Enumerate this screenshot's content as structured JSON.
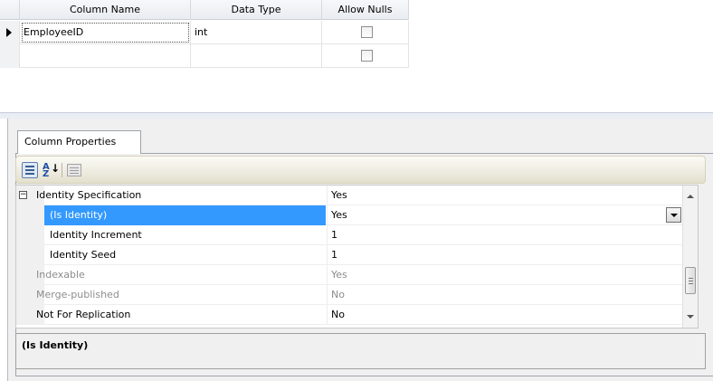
{
  "grid": {
    "columns": [
      "Column Name",
      "Data Type",
      "Allow Nulls"
    ],
    "rows": [
      {
        "name": "EmployeeID",
        "type": "int",
        "allow_nulls": false,
        "current": true
      },
      {
        "name": "",
        "type": "",
        "allow_nulls": false,
        "current": false
      }
    ]
  },
  "panel": {
    "tab_label": "Column Properties",
    "toolbar": [
      "categorized-icon",
      "alphabetical-sort-icon",
      "property-pages-icon"
    ],
    "properties": [
      {
        "name": "Identity Specification",
        "value": "Yes",
        "category": true,
        "expanded": true
      },
      {
        "name": "(Is Identity)",
        "value": "Yes",
        "selected": true
      },
      {
        "name": "Identity Increment",
        "value": "1"
      },
      {
        "name": "Identity Seed",
        "value": "1"
      },
      {
        "name": "Indexable",
        "value": "Yes",
        "readonly": true
      },
      {
        "name": "Merge-published",
        "value": "No",
        "readonly": true
      },
      {
        "name": "Not For Replication",
        "value": "No"
      }
    ],
    "description_title": "(Is Identity)",
    "colors": {
      "selection": "#3399ff",
      "readonly_text": "#8d8d8d"
    }
  }
}
